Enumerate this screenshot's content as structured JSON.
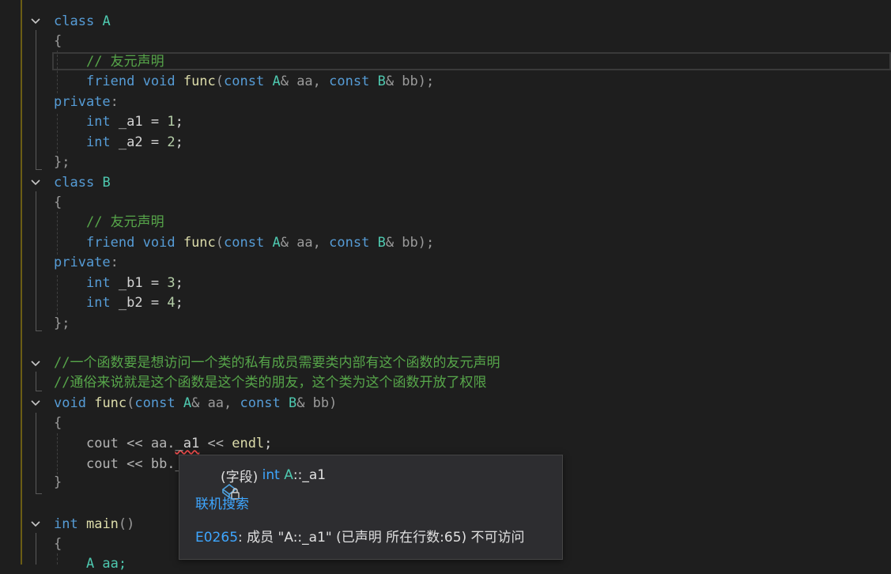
{
  "code": {
    "l_class_a": "class A",
    "l_brace_open": "{",
    "l_comment_friend": "// 友元声明",
    "l_friend_kw": "friend",
    "l_void_kw": "void",
    "l_func_name": "func",
    "l_const_kw": "const",
    "l_type_a": "A",
    "l_type_b": "B",
    "l_amp_aa": "& aa, ",
    "l_amp_bb": "& bb);",
    "l_private": "private",
    "l_colon": ":",
    "l_int": "int",
    "l_a1": " _a1 = ",
    "l_a2": " _a2 = ",
    "l_b1": " _b1 = ",
    "l_b2": " _b2 = ",
    "n1": "1",
    "n2": "2",
    "n3": "3",
    "n4": "4",
    "semi": ";",
    "l_brace_close": "};",
    "l_class_kw": "class",
    "l_class_b_name": "B",
    "l_comment_1": "//一个函数要是想访问一个类的私有成员需要类内部有这个函数的友元声明",
    "l_comment_2": "//通俗来说就是这个函数是这个类的朋友，这个类为这个函数开放了权限",
    "l_func_sig_open": "(",
    "l_amp_bb_close": "& bb)",
    "l_cout_1_pre": "cout << aa.",
    "l_cout_1_mem": "_a1",
    "l_cout_1_post": " << ",
    "l_endl": "endl",
    "l_cout_2": "cout << bb._",
    "l_fn_close": "}",
    "l_int_main_kw": "int",
    "l_main": "main",
    "l_main_parens": "()",
    "l_a_aa": "A aa;"
  },
  "tooltip": {
    "kind": "(字段) ",
    "type": "int ",
    "cls": "A",
    "member": "::_a1",
    "search_link": "联机搜索",
    "error_code": "E0265",
    "error_msg": ": 成员 \"A::_a1\" (已声明 所在行数:65) 不可访问",
    "icon": "field-lock-icon"
  },
  "colors": {
    "background": "#1e1e1e",
    "keyword": "#569cd6",
    "type": "#4ec9b0",
    "function": "#dcdcaa",
    "comment": "#57a64a",
    "number": "#b5cea8",
    "error_underline": "#f14c4c",
    "link": "#3ea6ff"
  }
}
